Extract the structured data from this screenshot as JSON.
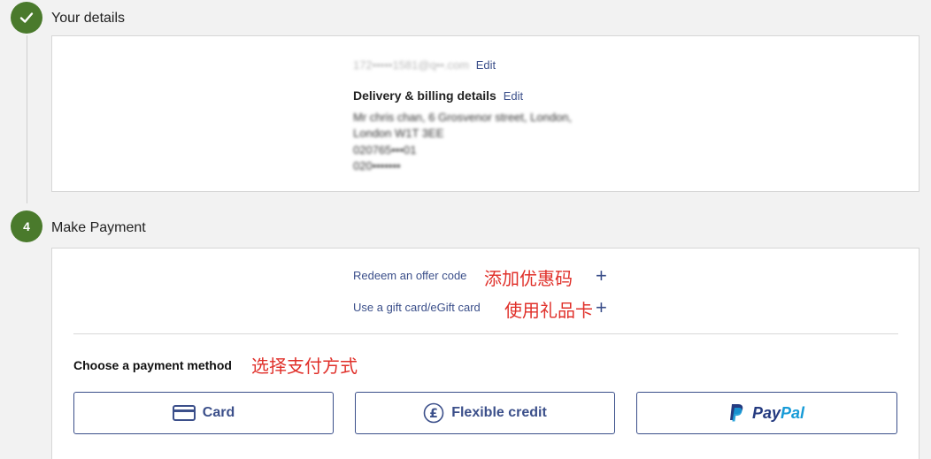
{
  "step_done": {
    "title": "Your details",
    "icon": "check-icon"
  },
  "details": {
    "email": "172•••••1581@q••.com",
    "email_edit": "Edit",
    "delivery_heading": "Delivery & billing details",
    "delivery_edit": "Edit",
    "address_line1": "Mr chris chan, 6 Grosvenor street, London,",
    "address_line2": "London W1T 3EE",
    "phone1": "020765•••01",
    "phone2": "020•••••••"
  },
  "step4": {
    "number": "4",
    "title": "Make Payment",
    "offer_link": "Redeem an offer code",
    "offer_note": "添加优惠码",
    "gift_link": "Use a gift card/eGift card",
    "gift_note": "使用礼品卡",
    "plus": "+",
    "choose_label": "Choose a payment method",
    "choose_note": "选择支付方式",
    "methods": {
      "card": "Card",
      "credit": "Flexible credit",
      "paypal_a": "Pay",
      "paypal_b": "Pal"
    }
  },
  "colors": {
    "accent": "#3b4f8a",
    "step_green": "#4a7a2c",
    "annotation_red": "#e0302a",
    "paypal_dark": "#253b80",
    "paypal_light": "#179bd7"
  }
}
